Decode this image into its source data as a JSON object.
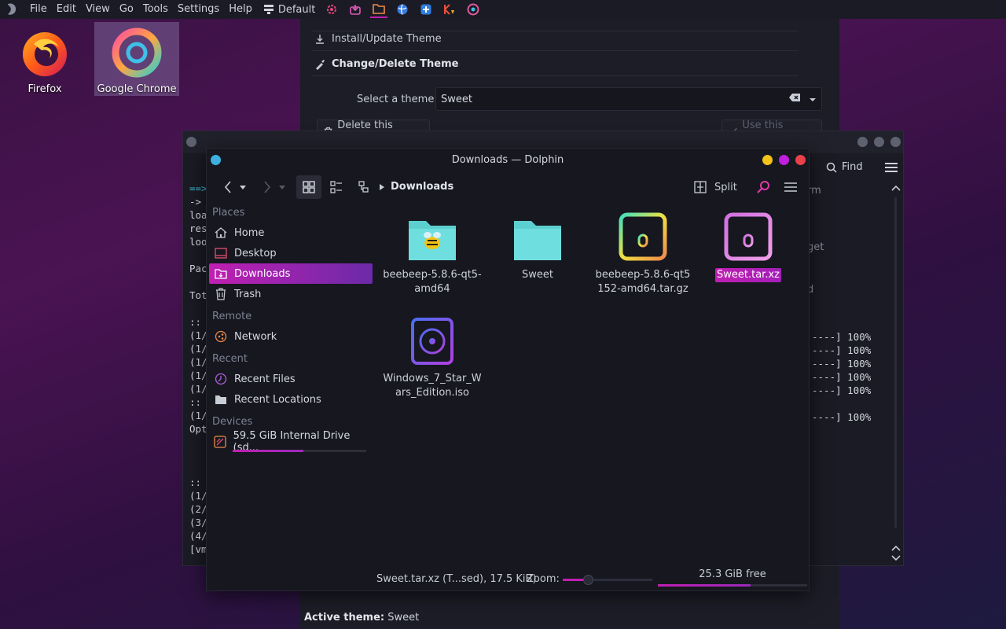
{
  "top_panel": {
    "menus": [
      "File",
      "Edit",
      "View",
      "Go",
      "Tools",
      "Settings",
      "Help"
    ],
    "theme_label": "Default",
    "launchers": [
      "settings-icon",
      "discover-icon",
      "folder-icon",
      "browser-icon",
      "software-icon",
      "kate-icon",
      "chrome-icon"
    ]
  },
  "desktop": {
    "icons": [
      {
        "label": "Firefox"
      },
      {
        "label": "Google Chrome"
      }
    ]
  },
  "theme_manager": {
    "install_label": "Install/Update Theme",
    "change_label": "Change/Delete Theme",
    "select_label": "Select a theme:",
    "selected_theme": "Sweet",
    "delete_button": "Delete this theme",
    "use_button": "Use this theme",
    "active_theme_label": "Active theme:",
    "active_theme_value": "Sweet"
  },
  "terminal": {
    "find_label": "Find",
    "left_fragments": [
      "==>",
      " ->",
      "loa",
      "res",
      "loo",
      "",
      "Pac",
      "",
      "Tot",
      "",
      ":: ",
      "(1/",
      "(1/",
      "(1/",
      "(1/",
      "(1/",
      ":: ",
      "(1/",
      "Opt",
      "",
      "",
      "",
      ":: ",
      "(1/",
      "(2/",
      "(3/",
      "(4/",
      "[vm"
    ],
    "right_fragments": [
      "rm",
      "get",
      "d"
    ],
    "progress_lines": [
      "----] 100%",
      "----] 100%",
      "----] 100%",
      "----] 100%",
      "----] 100%",
      "",
      "----] 100%"
    ]
  },
  "dolphin": {
    "title": "Downloads — Dolphin",
    "breadcrumb": "Downloads",
    "split_label": "Split",
    "places": {
      "header_places": "Places",
      "home": "Home",
      "desktop": "Desktop",
      "downloads": "Downloads",
      "trash": "Trash",
      "header_remote": "Remote",
      "network": "Network",
      "header_recent": "Recent",
      "recent_files": "Recent Files",
      "recent_locations": "Recent Locations",
      "header_devices": "Devices",
      "drive": "59.5 GiB Internal Drive (sd...",
      "drive_used_fraction": 0.53
    },
    "files": [
      {
        "name": "beebeep-5.8.6-qt5-amd64",
        "icon": "bee-folder-icon"
      },
      {
        "name": "Sweet",
        "icon": "folder-icon"
      },
      {
        "name": "beebeep-5.8.6-qt5152-amd64.tar.gz",
        "icon": "archive-icon"
      },
      {
        "name": "Sweet.tar.xz",
        "icon": "archive-icon",
        "selected": true
      },
      {
        "name": "Windows_7_Star_Wars_Edition.iso",
        "icon": "disc-image-icon"
      }
    ],
    "status": {
      "selection": "Sweet.tar.xz (T...sed), 17.5 KiB)",
      "zoom_label": "Zoom:",
      "zoom_fraction": 0.28,
      "free_space": "25.3 GiB free",
      "free_used_fraction": 0.62
    }
  },
  "colors": {
    "accent": "#c01fb2",
    "panel_bg": "#1b1b25",
    "window_bg": "#16171f"
  }
}
